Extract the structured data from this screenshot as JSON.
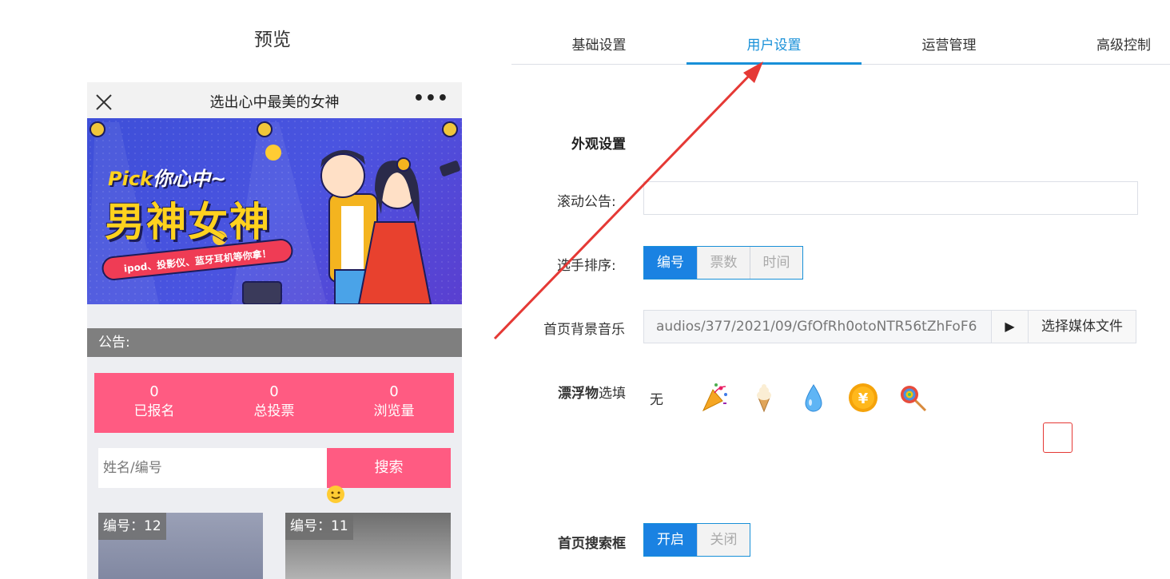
{
  "preview": {
    "title": "预览",
    "phone": {
      "title": "选出心中最美的女神",
      "more": "•••",
      "banner": {
        "pick_en": "Pick",
        "pick_cn": "你心中~",
        "headline": "男神女神",
        "ribbon": "ipod、投影仪、蓝牙耳机等你拿！"
      },
      "notice_label": "公告:",
      "stats": [
        {
          "value": "0",
          "label": "已报名"
        },
        {
          "value": "0",
          "label": "总投票"
        },
        {
          "value": "0",
          "label": "浏览量"
        }
      ],
      "search": {
        "placeholder": "姓名/编号",
        "button": "搜索"
      },
      "cards": [
        {
          "tag": "编号：12"
        },
        {
          "tag": "编号：11"
        }
      ]
    }
  },
  "tabs": [
    {
      "label": "基础设置"
    },
    {
      "label": "用户设置"
    },
    {
      "label": "运营管理"
    },
    {
      "label": "高级控制"
    }
  ],
  "active_tab": "用户设置",
  "settings": {
    "section_title": "外观设置",
    "marquee": {
      "label": "滚动公告:",
      "value": ""
    },
    "sort": {
      "label": "选手排序:",
      "options": [
        "编号",
        "票数",
        "时间"
      ],
      "selected": "编号"
    },
    "music": {
      "label": "首页背景音乐",
      "path": "audios/377/2021/09/GfOfRh0otoNTR56tZhFoF6",
      "play": "▶",
      "choose": "选择媒体文件"
    },
    "float": {
      "label_bold": "漂浮物",
      "label_rest": "选填",
      "options": [
        "无",
        "party-popper-icon",
        "ice-cream-icon",
        "water-drop-icon",
        "yen-coin-icon",
        "lollipop-icon"
      ]
    },
    "home_search": {
      "label": "首页搜索框",
      "options": [
        "开启",
        "关闭"
      ],
      "selected": "开启"
    }
  },
  "colors": {
    "accent": "#1890d8",
    "pink": "#ff5b82",
    "arrow": "#e53935"
  }
}
